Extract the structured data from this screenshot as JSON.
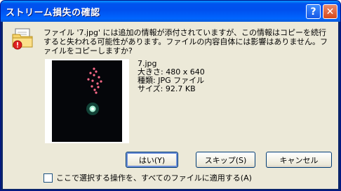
{
  "dialog": {
    "title": "ストリーム損失の確認",
    "help_glyph": "?",
    "close_glyph": "✕"
  },
  "message": "ファイル '7.jpg' には追加の情報が添付されていますが、この情報はコピーを続行すると失われる可能性があります。ファイルの内容自体には影響はありません。ファイルをコピーしますか?",
  "file": {
    "name": "7.jpg",
    "size_dimensions": "大きさ: 480 x 640",
    "type": "種類: JPG ファイル",
    "filesize": "サイズ: 92.7 KB"
  },
  "buttons": {
    "yes": "はい(Y)",
    "skip": "スキップ(S)",
    "cancel": "キャンセル"
  },
  "checkbox": {
    "label": "ここで選択する操作を、すべてのファイルに適用する(A)",
    "checked": false
  },
  "icons": {
    "dialog_icon": "folder-warning-icon",
    "help": "help-icon",
    "close": "close-icon"
  },
  "colors": {
    "titlebar": "#0053ee",
    "client_bg": "#ece9d8",
    "warning_red": "#e02020"
  }
}
